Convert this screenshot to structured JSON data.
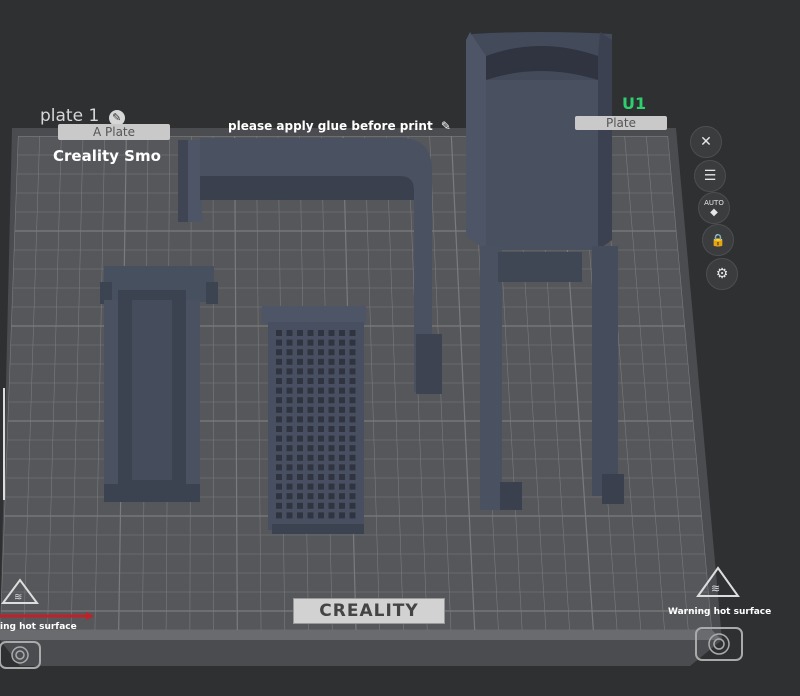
{
  "plate": {
    "title": "plate 1",
    "label_left": "A Plate",
    "label_right": "Plate",
    "glue_note": "please apply glue before print",
    "printer_name": "Creality Smo",
    "corner_tag": "U1"
  },
  "bed": {
    "brand": "CREALITY",
    "warning_left": "ing hot surface",
    "warning_right": "Warning hot surface"
  },
  "toolbar": {
    "close_symbol": "✕",
    "arrange_symbol": "☰",
    "auto_label": "AUTO",
    "lock_symbol": "🔒",
    "settings_symbol": "⚙"
  },
  "colors": {
    "background": "#2f3032",
    "bed": "#5a5b5e",
    "grid": "#7a7b7e",
    "model": "#4a5060",
    "accent": "#2ed06e"
  }
}
